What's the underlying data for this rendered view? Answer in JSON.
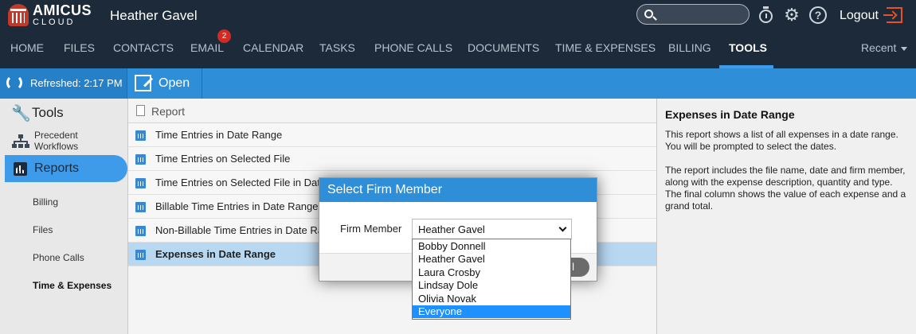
{
  "header": {
    "logo_main": "AMICUS",
    "logo_sub": "CLOUD",
    "username": "Heather Gavel",
    "search_placeholder": "",
    "logout_label": "Logout"
  },
  "nav": {
    "items": [
      {
        "label": "HOME"
      },
      {
        "label": "FILES"
      },
      {
        "label": "CONTACTS"
      },
      {
        "label": "EMAIL"
      },
      {
        "label": "CALENDAR"
      },
      {
        "label": "TASKS"
      },
      {
        "label": "PHONE CALLS"
      },
      {
        "label": "DOCUMENTS"
      },
      {
        "label": "TIME & EXPENSES"
      },
      {
        "label": "BILLING"
      },
      {
        "label": "TOOLS"
      }
    ],
    "email_badge": "2",
    "active": "TOOLS",
    "recent_label": "Recent"
  },
  "toolbar": {
    "refreshed_label": "Refreshed: 2:17 PM",
    "open_label": "Open"
  },
  "sidebar": {
    "tools_label": "Tools",
    "precedent_label": "Precedent Workflows",
    "reports_label": "Reports",
    "sub_items": [
      {
        "label": "Billing"
      },
      {
        "label": "Files"
      },
      {
        "label": "Phone Calls"
      },
      {
        "label": "Time & Expenses"
      }
    ]
  },
  "list": {
    "header_label": "Report",
    "rows": [
      {
        "label": "Time Entries in Date Range"
      },
      {
        "label": "Time Entries on Selected File"
      },
      {
        "label": "Time Entries on Selected File in Date Range"
      },
      {
        "label": "Billable Time Entries in Date Range"
      },
      {
        "label": "Non-Billable Time Entries in Date Range"
      },
      {
        "label": "Expenses in Date Range"
      }
    ],
    "selected_row": "Expenses in Date Range"
  },
  "detail": {
    "title": "Expenses in Date Range",
    "paragraph1": "This report shows a list of all expenses in a date range. You will be prompted to select the dates.",
    "paragraph2": "The report includes the file name, date and firm member, along with the expense description, quantity and type. The final column shows the value of each expense and a grand total."
  },
  "modal": {
    "title": "Select Firm Member",
    "field_label": "Firm Member",
    "selected_value": "Heather Gavel",
    "button_label_visible": "l",
    "options": [
      {
        "label": "Bobby Donnell"
      },
      {
        "label": "Heather Gavel"
      },
      {
        "label": "Laura Crosby"
      },
      {
        "label": "Lindsay Dole"
      },
      {
        "label": "Olivia Novak"
      },
      {
        "label": "Everyone"
      }
    ],
    "highlighted_option": "Everyone"
  },
  "colors": {
    "topbar": "#1d2a3a",
    "accent": "#2f8ed8",
    "active_tab": "#3d9be9",
    "badge": "#d42a20",
    "selected_row": "#b8d8f2",
    "dropdown_highlight": "#1e90ff"
  }
}
